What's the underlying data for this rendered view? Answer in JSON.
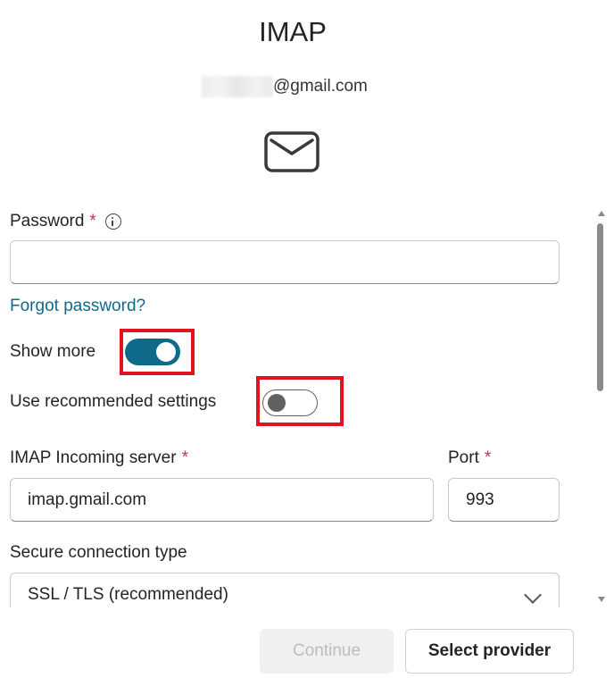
{
  "header": {
    "title": "IMAP",
    "email_visible": "@gmail.com",
    "mail_icon": "mail-envelope-icon"
  },
  "form": {
    "password": {
      "label": "Password",
      "required_mark": "*",
      "info_icon": "info-icon",
      "value": ""
    },
    "forgot_password_link": "Forgot password?",
    "show_more": {
      "label": "Show more",
      "checked": true
    },
    "use_recommended": {
      "label": "Use recommended settings",
      "checked": false
    },
    "incoming_server": {
      "label": "IMAP Incoming server",
      "required_mark": "*",
      "value": "imap.gmail.com"
    },
    "port": {
      "label": "Port",
      "required_mark": "*",
      "value": "993"
    },
    "secure_connection": {
      "label": "Secure connection type",
      "value": "SSL / TLS (recommended)"
    }
  },
  "footer": {
    "continue_label": "Continue",
    "select_provider_label": "Select provider"
  },
  "colors": {
    "accent": "#0f6a8a",
    "required": "#c4314b",
    "highlight": "#e0141e"
  }
}
